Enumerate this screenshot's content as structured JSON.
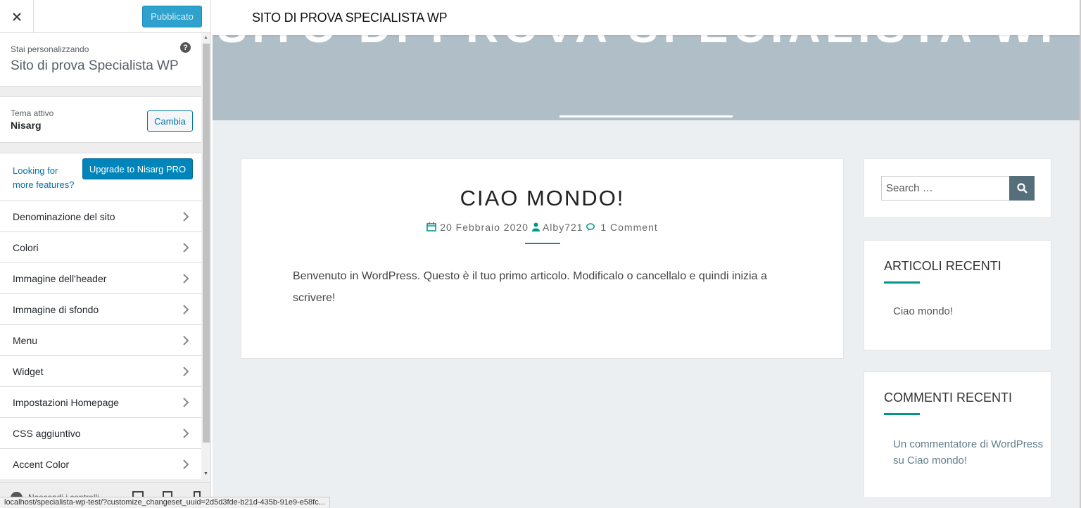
{
  "customizer": {
    "publish_label": "Pubblicato",
    "customizing_label": "Stai personalizzando",
    "site_name": "Sito di prova Specialista WP",
    "help_glyph": "?",
    "active_theme_label": "Tema attivo",
    "theme_name": "Nisarg",
    "change_label": "Cambia",
    "promo_text": "Looking for more features?",
    "upgrade_label": "Upgrade to Nisarg PRO",
    "panels": [
      {
        "label": "Denominazione del sito"
      },
      {
        "label": "Colori"
      },
      {
        "label": "Immagine dell'header"
      },
      {
        "label": "Immagine di sfondo"
      },
      {
        "label": "Menu"
      },
      {
        "label": "Widget"
      },
      {
        "label": "Impostazioni Homepage"
      },
      {
        "label": "CSS aggiuntivo"
      },
      {
        "label": "Accent Color"
      }
    ],
    "footer_text": "Nascondi i controlli"
  },
  "preview": {
    "brand": "SITO DI PROVA SPECIALISTA WP",
    "hero_title": "SITO DI PROVA SPECIALISTA WP",
    "post": {
      "title": "CIAO MONDO!",
      "date": "20 Febbraio 2020",
      "author": "Alby721",
      "comments": "1 Comment",
      "body": "Benvenuto in WordPress. Questo è il tuo primo articolo. Modificalo o cancellalo e quindi inizia a scrivere!"
    },
    "search_placeholder": "Search …",
    "recent_posts_title": "ARTICOLI RECENTI",
    "recent_post_link": "Ciao mondo!",
    "recent_comments_title": "COMMENTI RECENTI",
    "recent_comment": "Un commentatore di WordPress su Ciao mondo!"
  },
  "status_url": "localhost/specialista-wp-test/?customize_changeset_uuid=2d5d3fde-b21d-435b-91e9-e58fc...",
  "colors": {
    "accent": "#009688",
    "hero_bg": "#afbec7",
    "wp_blue": "#0073aa"
  }
}
